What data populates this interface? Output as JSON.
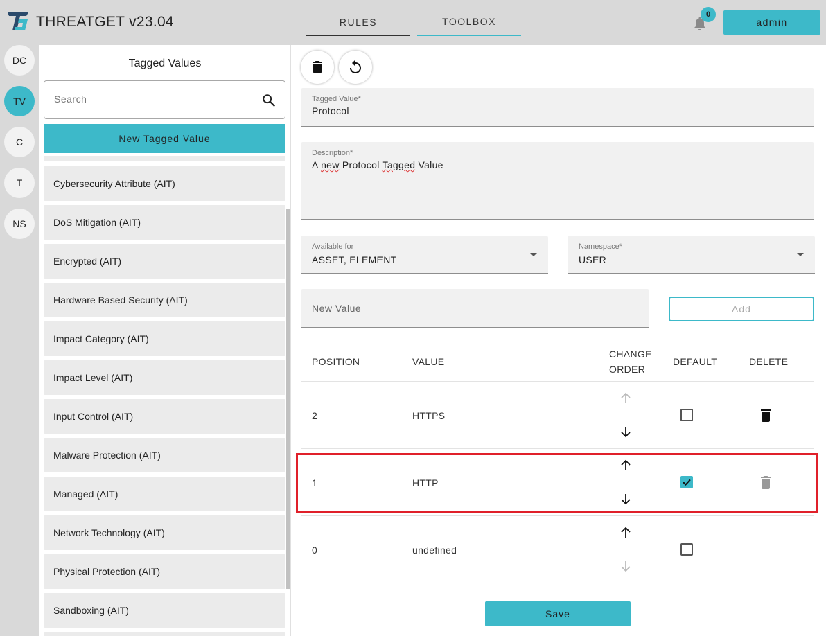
{
  "app": {
    "title": "THREATGET  v23.04"
  },
  "nav": {
    "tabs": [
      {
        "label": "RULES"
      },
      {
        "label": "TOOLBOX"
      }
    ],
    "active": "TOOLBOX"
  },
  "header": {
    "notification_count": "0",
    "user_label": "admin",
    "bell_icon": "bell-icon"
  },
  "rail": {
    "items": [
      {
        "label": "DC"
      },
      {
        "label": "TV",
        "active": true
      },
      {
        "label": "C"
      },
      {
        "label": "T"
      },
      {
        "label": "NS"
      }
    ]
  },
  "list": {
    "title": "Tagged Values",
    "search_placeholder": "Search",
    "new_button_label": "New Tagged Value",
    "items": [
      "Cybersecurity Attribute (AIT)",
      "DoS Mitigation (AIT)",
      "Encrypted (AIT)",
      "Hardware Based Security (AIT)",
      "Impact Category (AIT)",
      "Impact Level (AIT)",
      "Input Control (AIT)",
      "Malware Protection (AIT)",
      "Managed (AIT)",
      "Network Technology (AIT)",
      "Physical Protection (AIT)",
      "Sandboxing (AIT)"
    ]
  },
  "editor": {
    "tagged_value_label": "Tagged Value*",
    "tagged_value": "Protocol",
    "description_label": "Description*",
    "description_parts": [
      "A ",
      "new",
      " Protocol ",
      "Tagged",
      " Value"
    ],
    "available_for_label": "Available for",
    "available_for": "ASSET, ELEMENT",
    "namespace_label": "Namespace*",
    "namespace": "USER",
    "new_value_placeholder": "New Value",
    "add_label": "Add",
    "save_label": "Save"
  },
  "table": {
    "headers": {
      "position": "POSITION",
      "value": "VALUE",
      "change_order_1": "CHANGE",
      "change_order_2": "ORDER",
      "default": "DEFAULT",
      "delete": "DELETE"
    },
    "rows": [
      {
        "position": "2",
        "value": "HTTPS",
        "default": false,
        "up_enabled": false,
        "down_enabled": true,
        "delete_enabled": true
      },
      {
        "position": "1",
        "value": "HTTP",
        "default": true,
        "up_enabled": true,
        "down_enabled": true,
        "delete_enabled": false,
        "highlighted": true
      },
      {
        "position": "0",
        "value": "undefined",
        "default": false,
        "up_enabled": true,
        "down_enabled": false,
        "delete_enabled": null
      }
    ]
  },
  "colors": {
    "accent": "#3db9c9",
    "highlight": "#e0202a",
    "topbar": "#d9d9d9"
  }
}
